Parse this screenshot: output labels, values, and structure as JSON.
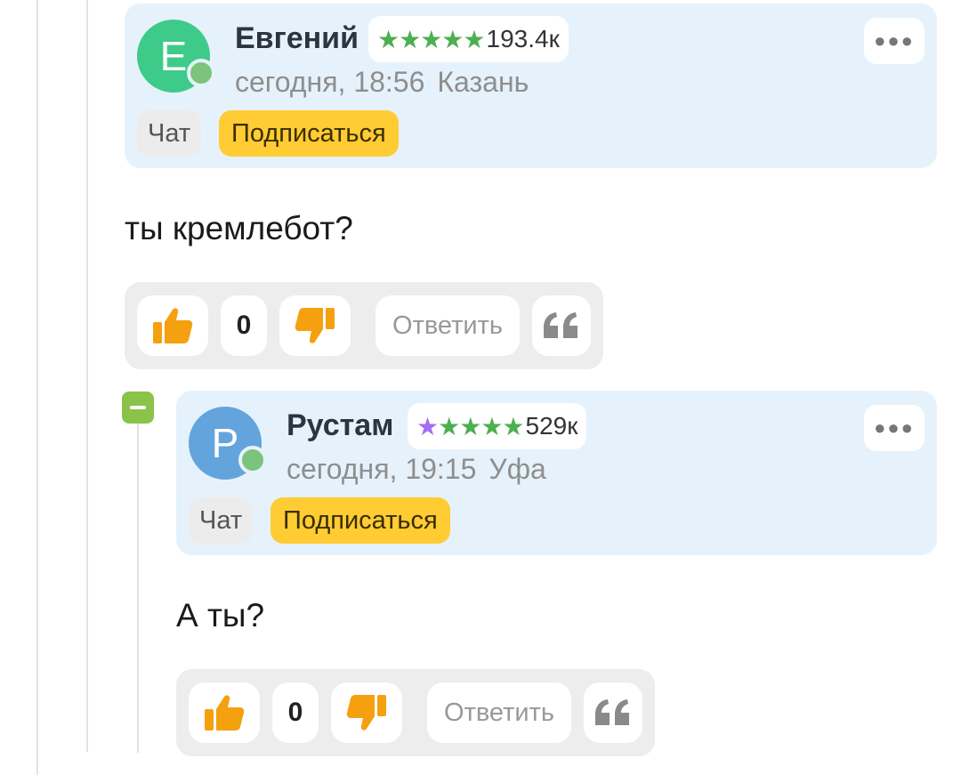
{
  "comments": [
    {
      "avatar_letter": "E",
      "avatar_color": "#3ecb8a",
      "author": "Евгений",
      "rating_value": "193.4к",
      "rating_first_star_color": "#4caf50",
      "date": "сегодня, 18:56",
      "city": "Казань",
      "chat_label": "Чат",
      "subscribe_label": "Подписаться",
      "text": "ты кремлебот?",
      "score": "0",
      "reply_label": "Ответить"
    },
    {
      "avatar_letter": "P",
      "avatar_color": "#64a4dc",
      "author": "Рустам",
      "rating_value": "529к",
      "rating_first_star_color": "#a56ef0",
      "date": "сегодня, 19:15",
      "city": "Уфа",
      "chat_label": "Чат",
      "subscribe_label": "Подписаться",
      "text": "А ты?",
      "score": "0",
      "reply_label": "Ответить"
    }
  ],
  "icons": {
    "like": "thumbs-up-icon",
    "dislike": "thumbs-down-icon",
    "quote": "quote-icon",
    "more": "more-dots-icon",
    "collapse": "collapse-minus-icon"
  },
  "colors": {
    "accent_yellow": "#ffcc33",
    "thumb_orange": "#f5a00f",
    "card_bg": "#e6f2fb",
    "online_green": "#7cc37e"
  }
}
